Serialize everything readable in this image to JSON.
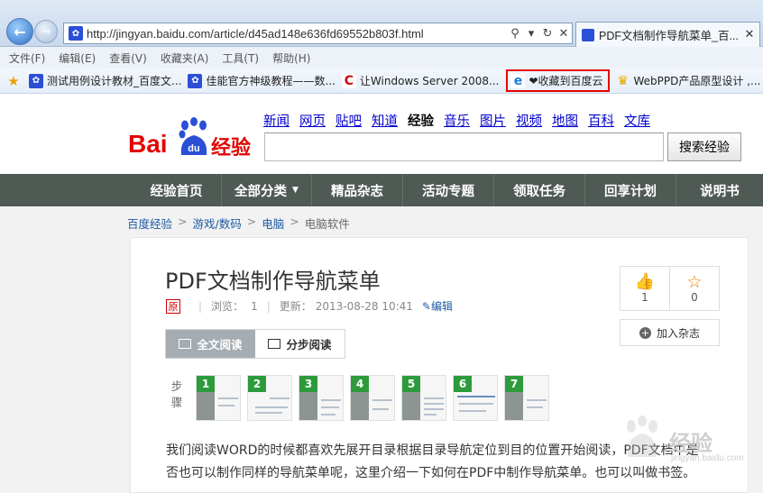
{
  "browser": {
    "address_url": "http://jingyan.baidu.com/article/d45ad148e636fd69552b803f.html",
    "tab_title": "PDF文档制作导航菜单_百...",
    "icons": [
      "back-arrow-icon",
      "forward-arrow-icon",
      "search-icon",
      "dropdown-icon",
      "refresh-icon",
      "stop-icon",
      "close-icon",
      "favorites-star-icon"
    ]
  },
  "menu": [
    "文件(F)",
    "编辑(E)",
    "查看(V)",
    "收藏夹(A)",
    "工具(T)",
    "帮助(H)"
  ],
  "favorites": [
    {
      "label": "测试用例设计教材_百度文...",
      "icon": "baidu-paw-icon"
    },
    {
      "label": "佳能官方神级教程——数...",
      "icon": "baidu-paw-icon"
    },
    {
      "label": "让Windows Server 2008...",
      "icon": "c-logo-icon"
    },
    {
      "label": "❤收藏到百度云",
      "icon": "ie-icon"
    },
    {
      "label": "WebPPD产品原型设计 ,...",
      "icon": "trophy-icon"
    }
  ],
  "logo": {
    "bai": "Bai",
    "du": "du",
    "jingyan": "经验"
  },
  "topnav": [
    "新闻",
    "网页",
    "贴吧",
    "知道",
    "经验",
    "音乐",
    "图片",
    "视频",
    "地图",
    "百科",
    "文库"
  ],
  "topnav_current": "经验",
  "search": {
    "button": "搜索经验",
    "value": ""
  },
  "mainnav": [
    "经验首页",
    "全部分类",
    "精品杂志",
    "活动专题",
    "领取任务",
    "回享计划",
    "说明书"
  ],
  "breadcrumb": [
    "百度经验",
    "游戏/数码",
    "电脑",
    "电脑软件"
  ],
  "article": {
    "title": "PDF文档制作导航菜单",
    "original_badge": "原",
    "views_label": "浏览：",
    "views": "1",
    "updated_label": "更新：",
    "updated": "2013-08-28 10:41",
    "edit": "编辑",
    "likes": "1",
    "favorites": "0",
    "add_magazine": "加入杂志",
    "read_full": "全文阅读",
    "read_step": "分步阅读",
    "steps_label": "步骤",
    "step_numbers": [
      "1",
      "2",
      "3",
      "4",
      "5",
      "6",
      "7"
    ],
    "intro": "我们阅读WORD的时候都喜欢先展开目录根据目录导航定位到目的位置开始阅读，PDF文档中是否也可以制作同样的导航菜单呢，这里介绍一下如何在PDF中制作导航菜单。也可以叫做书签。"
  },
  "watermark": {
    "text": "经验",
    "sub": "jingyan.baidu.com"
  },
  "colors": {
    "brand_red": "#e10602",
    "nav_bg": "#505a55",
    "link": "#1d5aa3",
    "step_green": "#2d9b3c",
    "highlight": "#e60000"
  }
}
